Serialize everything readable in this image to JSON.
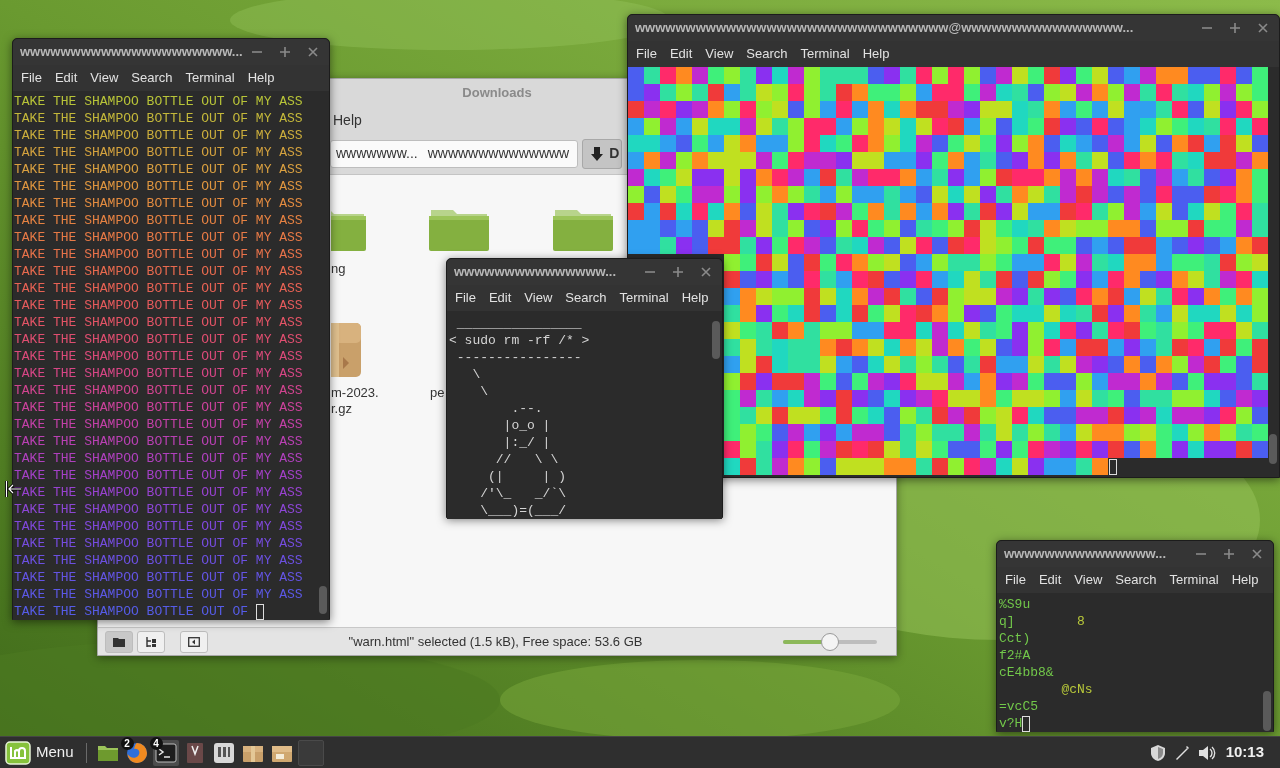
{
  "windows": [
    {
      "kind": "lolcat_terminal",
      "title": "wwwwwwwwwwwwwwwwwwwww...",
      "menu": [
        "File",
        "Edit",
        "View",
        "Search",
        "Terminal",
        "Help"
      ],
      "cursor": true,
      "lines": [
        {
          "text": "TAKE THE SHAMPOO BOTTLE OUT OF MY ASS",
          "color": "#b8c438"
        },
        {
          "text": "TAKE THE SHAMPOO BOTTLE OUT OF MY ASS",
          "color": "#c4b83a"
        },
        {
          "text": "TAKE THE SHAMPOO BOTTLE OUT OF MY ASS",
          "color": "#ccae3c"
        },
        {
          "text": "TAKE THE SHAMPOO BOTTLE OUT OF MY ASS",
          "color": "#d4a23e"
        },
        {
          "text": "TAKE THE SHAMPOO BOTTLE OUT OF MY ASS",
          "color": "#daa040"
        },
        {
          "text": "TAKE THE SHAMPOO BOTTLE OUT OF MY ASS",
          "color": "#e0963f"
        },
        {
          "text": "TAKE THE SHAMPOO BOTTLE OUT OF MY ASS",
          "color": "#e48c40"
        },
        {
          "text": "TAKE THE SHAMPOO BOTTLE OUT OF MY ASS",
          "color": "#e68242"
        },
        {
          "text": "TAKE THE SHAMPOO BOTTLE OUT OF MY ASS",
          "color": "#e87a46"
        },
        {
          "text": "TAKE THE SHAMPOO BOTTLE OUT OF MY ASS",
          "color": "#e8724a"
        },
        {
          "text": "TAKE THE SHAMPOO BOTTLE OUT OF MY ASS",
          "color": "#e86a4e"
        },
        {
          "text": "TAKE THE SHAMPOO BOTTLE OUT OF MY ASS",
          "color": "#e86254"
        },
        {
          "text": "TAKE THE SHAMPOO BOTTLE OUT OF MY ASS",
          "color": "#e65a5c"
        },
        {
          "text": "TAKE THE SHAMPOO BOTTLE OUT OF MY ASS",
          "color": "#e45466"
        },
        {
          "text": "TAKE THE SHAMPOO BOTTLE OUT OF MY ASS",
          "color": "#e04e70"
        },
        {
          "text": "TAKE THE SHAMPOO BOTTLE OUT OF MY ASS",
          "color": "#dc4a7a"
        },
        {
          "text": "TAKE THE SHAMPOO BOTTLE OUT OF MY ASS",
          "color": "#d84686"
        },
        {
          "text": "TAKE THE SHAMPOO BOTTLE OUT OF MY ASS",
          "color": "#d24490"
        },
        {
          "text": "TAKE THE SHAMPOO BOTTLE OUT OF MY ASS",
          "color": "#cc429c"
        },
        {
          "text": "TAKE THE SHAMPOO BOTTLE OUT OF MY ASS",
          "color": "#c440a8"
        },
        {
          "text": "TAKE THE SHAMPOO BOTTLE OUT OF MY ASS",
          "color": "#ba40b4"
        },
        {
          "text": "TAKE THE SHAMPOO BOTTLE OUT OF MY ASS",
          "color": "#b040be"
        },
        {
          "text": "TAKE THE SHAMPOO BOTTLE OUT OF MY ASS",
          "color": "#a440c8"
        },
        {
          "text": "TAKE THE SHAMPOO BOTTLE OUT OF MY ASS",
          "color": "#9842d0"
        },
        {
          "text": "TAKE THE SHAMPOO BOTTLE OUT OF MY ASS",
          "color": "#8c46d6"
        },
        {
          "text": "TAKE THE SHAMPOO BOTTLE OUT OF MY ASS",
          "color": "#8048dc"
        },
        {
          "text": "TAKE THE SHAMPOO BOTTLE OUT OF MY ASS",
          "color": "#764ce0"
        },
        {
          "text": "TAKE THE SHAMPOO BOTTLE OUT OF MY ASS",
          "color": "#6c50e2"
        },
        {
          "text": "TAKE THE SHAMPOO BOTTLE OUT OF MY ASS",
          "color": "#6454e4"
        },
        {
          "text": "TAKE THE SHAMPOO BOTTLE OUT OF MY ASS",
          "color": "#5c58e6"
        },
        {
          "text": "TAKE THE SHAMPOO BOTTLE OUT OF",
          "color": "#565ce8"
        }
      ]
    },
    {
      "kind": "file_manager",
      "title": "Downloads",
      "menu": [
        "Help"
      ],
      "path": [
        "wwwwwww...",
        "wwwwwwwwwwwwww"
      ],
      "path_button": "D",
      "items": [
        {
          "kind": "folder",
          "label": [
            "ng"
          ]
        },
        {
          "kind": "folder"
        },
        {
          "kind": "folder"
        },
        {
          "kind": "archive",
          "label": [
            "m-2023.",
            "r.gz"
          ]
        },
        {
          "kind": "hidden",
          "label": [
            "pe"
          ]
        }
      ],
      "view_buttons": [
        {
          "selected": true
        },
        {
          "selected": false
        }
      ],
      "status": "\"warn.html\" selected (1.5 kB), Free space: 53.6 GB",
      "zoom": {
        "level": 0.5
      }
    },
    {
      "kind": "cowsay_terminal",
      "title": "wwwwwwwwwwwwwww...",
      "menu": [
        "File",
        "Edit",
        "View",
        "Search",
        "Terminal",
        "Help"
      ],
      "lines": [
        " ________________",
        "< sudo rm -rf /* >",
        " ----------------",
        "   \\",
        "    \\",
        "        .--.",
        "       |o_o |",
        "       |:_/ |",
        "      //   \\ \\",
        "     (|     | )",
        "    /'\\_   _/`\\",
        "    \\___)=(___/"
      ]
    },
    {
      "kind": "blocks_terminal",
      "title": "wwwwwwwwwwwwwwwwwwwwwwwwwwwwwww@wwwwwwwwwwwwwwww...",
      "menu": [
        "File",
        "Edit",
        "View",
        "Search",
        "Terminal",
        "Help"
      ],
      "cursor": true
    },
    {
      "kind": "text_terminal",
      "title": "wwwwwwwwwwwwwww...",
      "menu": [
        "File",
        "Edit",
        "View",
        "Search",
        "Terminal",
        "Help"
      ],
      "cursor": true,
      "lines": [
        [
          {
            "text": "%S9u",
            "color": "#72c84a"
          }
        ],
        [
          {
            "text": "q]",
            "color": "#72c84a"
          },
          {
            "text": "        8",
            "color": "#b8c83a"
          }
        ],
        [
          {
            "text": "Cct)",
            "color": "#72c84a"
          }
        ],
        [
          {
            "text": "f2#A",
            "color": "#72c84a"
          }
        ],
        [
          {
            "text": "cE4bb8&",
            "color": "#72c84a"
          }
        ],
        [
          {
            "text": "        @cNs",
            "color": "#b8c83a"
          }
        ],
        [
          {
            "text": "=vcC5",
            "color": "#72c84a"
          }
        ],
        [
          {
            "text": "v?H",
            "color": "#72c84a"
          }
        ]
      ]
    }
  ],
  "taskbar": {
    "menu_label": "Menu",
    "apps": [
      {
        "kind": "files",
        "active": false
      },
      {
        "kind": "browser",
        "badge": "2",
        "active": false
      },
      {
        "kind": "terminal",
        "badge": "4",
        "active": true
      },
      {
        "kind": "document",
        "active": false
      },
      {
        "kind": "panel",
        "active": false
      },
      {
        "kind": "box",
        "active": false
      },
      {
        "kind": "box2",
        "active": false
      },
      {
        "kind": "empty",
        "active": false
      }
    ],
    "clock": "10:13"
  }
}
